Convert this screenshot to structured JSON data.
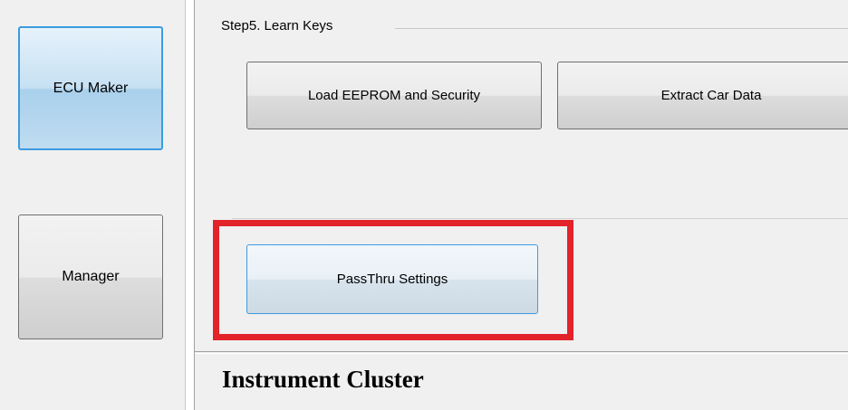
{
  "sidebar": {
    "buttons": [
      {
        "label": "ECU Maker",
        "selected": true
      },
      {
        "label": "Manager",
        "selected": false
      }
    ]
  },
  "step": {
    "title": "Step5. Learn Keys",
    "buttons": [
      {
        "label": "Load EEPROM and Security"
      },
      {
        "label": "Extract Car Data"
      }
    ]
  },
  "settings": {
    "passthru_label": "PassThru Settings"
  },
  "section": {
    "title": "Instrument Cluster"
  },
  "colors": {
    "highlight": "#e3232a",
    "selected_border": "#3c9be0"
  }
}
